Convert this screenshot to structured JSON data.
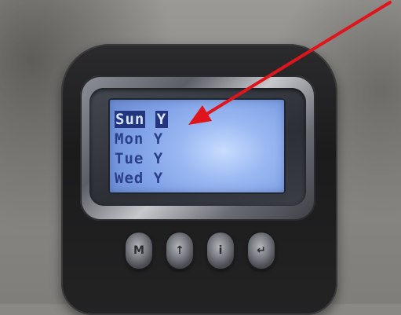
{
  "lcd": {
    "rows": [
      {
        "day": "Sun",
        "flag": "Y",
        "selected": true
      },
      {
        "day": "Mon",
        "flag": "Y",
        "selected": false
      },
      {
        "day": "Tue",
        "flag": "Y",
        "selected": false
      },
      {
        "day": "Wed",
        "flag": "Y",
        "selected": false
      }
    ],
    "background_color": "#9ab8f2",
    "text_color": "#2a3f8a",
    "highlight_color": "#23357d"
  },
  "keypad": {
    "buttons": [
      {
        "name": "menu-button",
        "glyph": "M"
      },
      {
        "name": "up-button",
        "glyph": "↑"
      },
      {
        "name": "info-button",
        "glyph": "i"
      },
      {
        "name": "enter-button",
        "glyph": "↵"
      }
    ]
  },
  "annotation": {
    "arrow_color": "#e0141b",
    "icon": "red-arrow-icon"
  }
}
